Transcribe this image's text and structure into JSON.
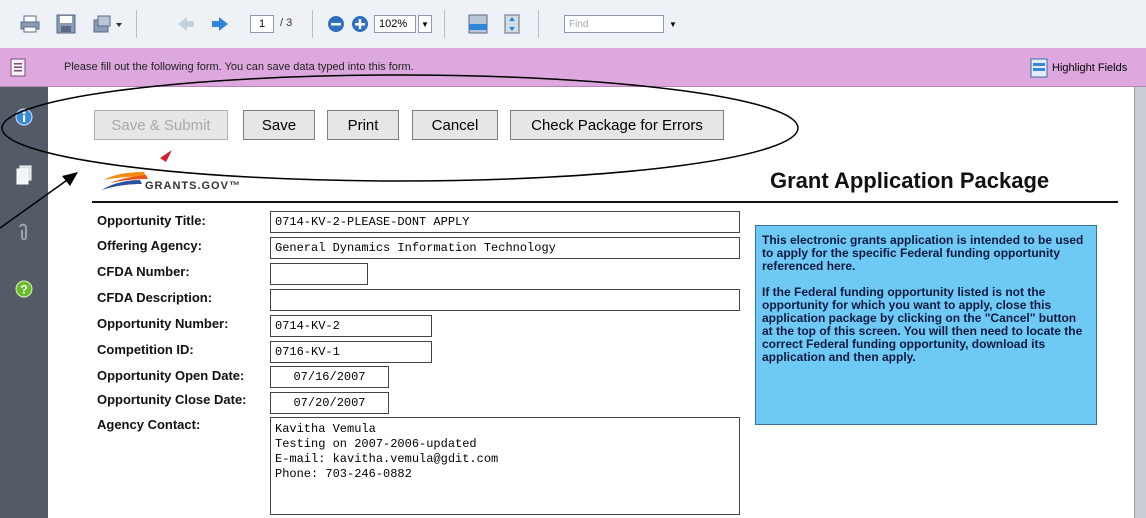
{
  "toolbar": {
    "page_current": "1",
    "page_total": "/ 3",
    "zoom": "102%",
    "find_placeholder": "Find"
  },
  "notify": {
    "message": "Please fill out the following form. You can save data typed into this form.",
    "highlight_label": "Highlight Fields"
  },
  "form_buttons": {
    "save_submit": "Save & Submit",
    "save": "Save",
    "print": "Print",
    "cancel": "Cancel",
    "check": "Check Package for Errors"
  },
  "header": {
    "logo_text": "GRANTS.GOV™",
    "title": "Grant Application Package"
  },
  "form": {
    "opportunity_title": {
      "label": "Opportunity Title:",
      "value": "0714-KV-2-PLEASE-DONT APPLY"
    },
    "offering_agency": {
      "label": "Offering Agency:",
      "value": "General Dynamics Information Technology"
    },
    "cfda_number": {
      "label": "CFDA Number:",
      "value": ""
    },
    "cfda_description": {
      "label": "CFDA Description:",
      "value": ""
    },
    "opportunity_number": {
      "label": "Opportunity Number:",
      "value": "0714-KV-2"
    },
    "competition_id": {
      "label": "Competition ID:",
      "value": "0716-KV-1"
    },
    "open_date": {
      "label": "Opportunity Open Date:",
      "value": "07/16/2007"
    },
    "close_date": {
      "label": "Opportunity Close Date:",
      "value": "07/20/2007"
    },
    "agency_contact": {
      "label": "Agency Contact:",
      "lines": [
        "Kavitha Vemula",
        "Testing on 2007-2006-updated",
        "E-mail: kavitha.vemula@gdit.com",
        "Phone: 703-246-0882"
      ]
    }
  },
  "info": {
    "para1": "This electronic grants application is intended to be used to apply for the specific Federal funding opportunity referenced here.",
    "para2": "If the Federal funding opportunity listed is not the opportunity for which you want to apply, close this application package by clicking on the \"Cancel\" button at the top of this screen. You will  then need to locate the correct Federal funding opportunity, download its application and then apply."
  },
  "colors": {
    "notify_bg": "#dca8de",
    "info_bg": "#6ec9f4",
    "nav_bg": "#535b66"
  }
}
